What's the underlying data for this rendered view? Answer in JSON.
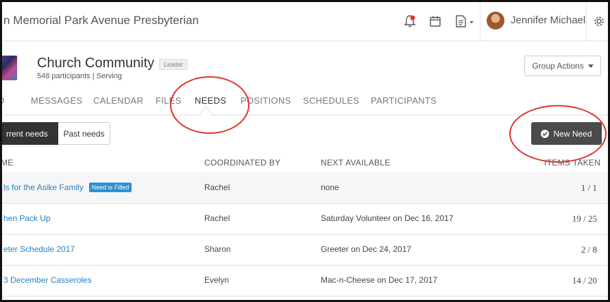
{
  "topbar": {
    "org_title": "n Memorial Park Avenue Presbyterian",
    "user_name": "Jennifer Michael"
  },
  "group": {
    "name": "Church Community",
    "role": "Leader",
    "meta": "548 participants | Serving",
    "actions_label": "Group Actions"
  },
  "tabs": [
    {
      "label": "D"
    },
    {
      "label": "MESSAGES"
    },
    {
      "label": "CALENDAR"
    },
    {
      "label": "FILES"
    },
    {
      "label": "NEEDS",
      "active": true
    },
    {
      "label": "POSITIONS"
    },
    {
      "label": "SCHEDULES"
    },
    {
      "label": "PARTICIPANTS"
    }
  ],
  "filters": {
    "current": "rrent needs",
    "past": "Past needs",
    "new_need": "New Need"
  },
  "table": {
    "headers": {
      "name": "ME",
      "coordinated_by": "COORDINATED BY",
      "next_available": "NEXT AVAILABLE",
      "items_taken": "ITEMS TAKEN"
    },
    "rows": [
      {
        "name": "ls for the Asike Family",
        "badge": "Need is Filled",
        "coordinator": "Rachel",
        "next": "none",
        "items": "1 / 1"
      },
      {
        "name": "hen Pack Up",
        "badge": "",
        "coordinator": "Rachel",
        "next": "Saturday Volunteer on Dec 16, 2017",
        "items": "19 / 25"
      },
      {
        "name": "eter Schedule 2017",
        "badge": "",
        "coordinator": "Sharon",
        "next": "Greeter on Dec 24, 2017",
        "items": "2 / 8"
      },
      {
        "name": "3 December Casseroles",
        "badge": "",
        "coordinator": "Evelyn",
        "next": "Mac-n-Cheese on Dec 17, 2017",
        "items": "14 / 20"
      }
    ]
  },
  "colors": {
    "link": "#2a7fbd",
    "annotation": "#e0342b",
    "badge": "#2d8fd5"
  }
}
